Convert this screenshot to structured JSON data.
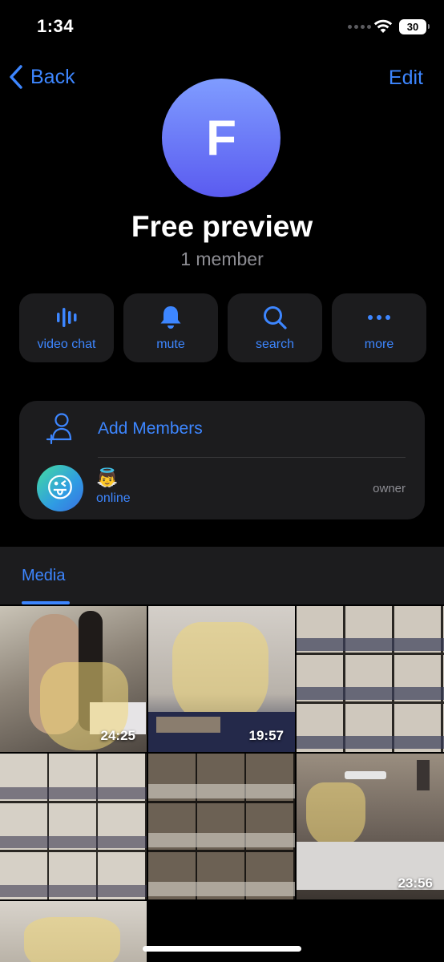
{
  "status_bar": {
    "time": "1:34",
    "battery": "30"
  },
  "nav": {
    "back_label": "Back",
    "edit_label": "Edit"
  },
  "profile": {
    "avatar_letter": "F",
    "title": "Free preview",
    "subtitle": "1 member"
  },
  "actions": [
    {
      "label": "video chat",
      "icon": "voice-waves-icon"
    },
    {
      "label": "mute",
      "icon": "bell-icon"
    },
    {
      "label": "search",
      "icon": "magnifier-icon"
    },
    {
      "label": "more",
      "icon": "ellipsis-icon"
    }
  ],
  "members": {
    "add_label": "Add Members",
    "list": [
      {
        "name": "👼",
        "status": "online",
        "role": "owner",
        "avatar_emoji": "😜"
      }
    ]
  },
  "media": {
    "tab_label": "Media",
    "items": [
      {
        "duration": "24:25"
      },
      {
        "duration": "19:57"
      },
      {
        "duration": ""
      },
      {
        "duration": ""
      },
      {
        "duration": ""
      },
      {
        "duration": "23:56"
      },
      {
        "duration": ""
      }
    ]
  },
  "colors": {
    "accent": "#3d86ff",
    "card": "#1c1c1e",
    "background": "#000000"
  }
}
